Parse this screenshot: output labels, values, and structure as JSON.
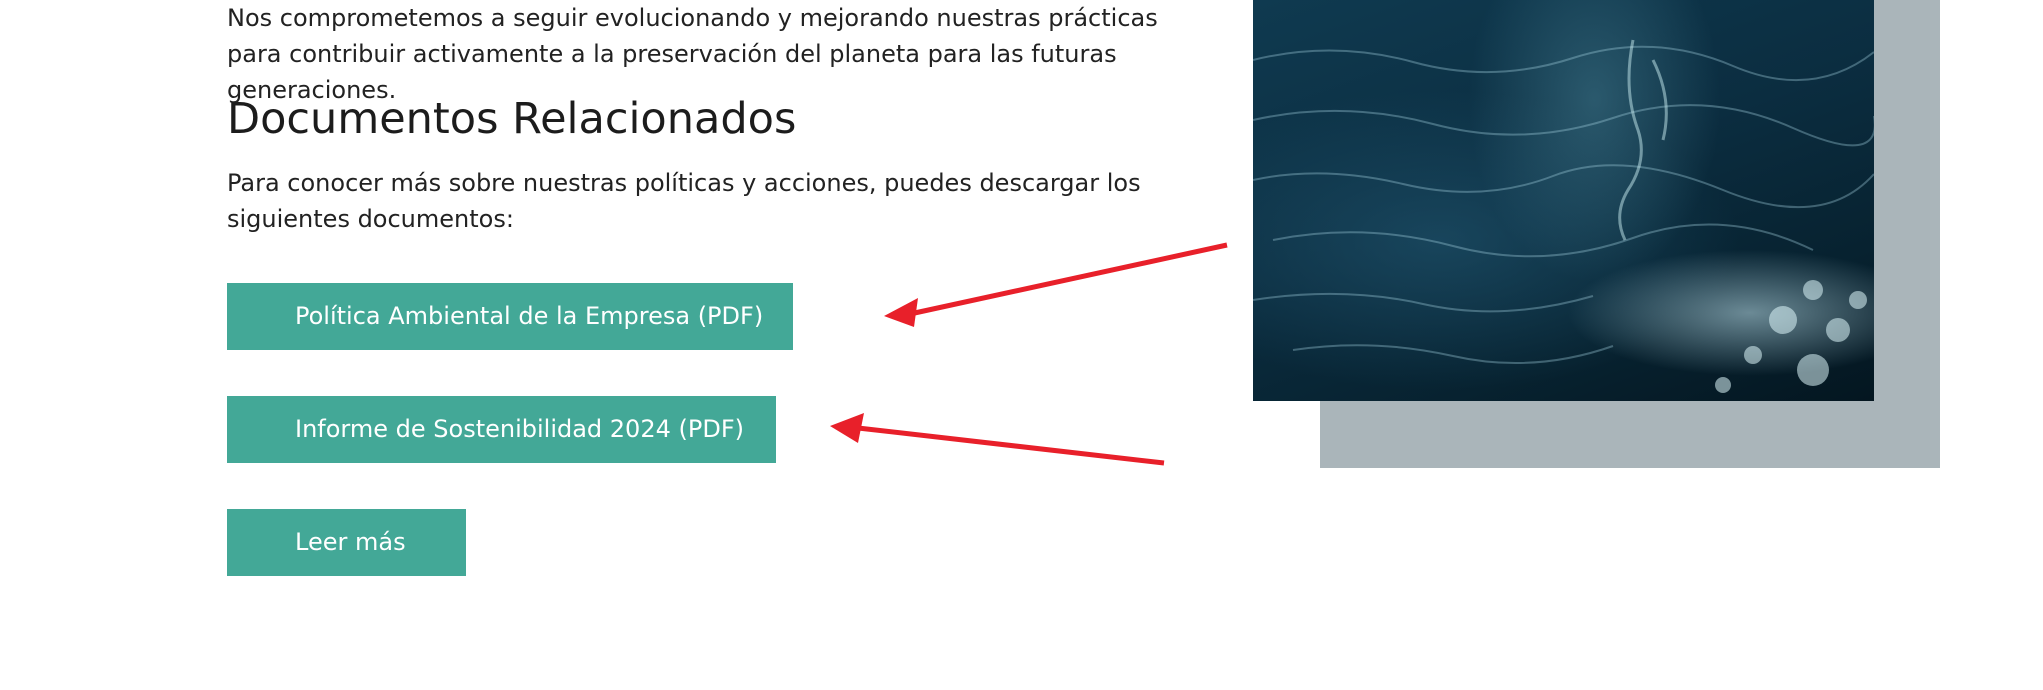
{
  "content": {
    "intro_paragraph": "Nos comprometemos a seguir evolucionando y mejorando nuestras prácticas para contribuir activamente a la preservación del planeta para las futuras generaciones.",
    "heading": "Documentos Relacionados",
    "description": "Para conocer más sobre nuestras políticas y acciones, puedes descargar los siguientes documentos:"
  },
  "buttons": {
    "policy_pdf": "Política Ambiental de la Empresa (PDF)",
    "sustainability_report_pdf": "Informe de Sostenibilidad 2024 (PDF)",
    "read_more": "Leer más"
  },
  "colors": {
    "button_bg": "#43a897",
    "button_text": "#ffffff",
    "frame_gray": "#aab5ba",
    "annotation_arrow": "#e8202a"
  },
  "image": {
    "subject": "ocean-water-photo"
  }
}
